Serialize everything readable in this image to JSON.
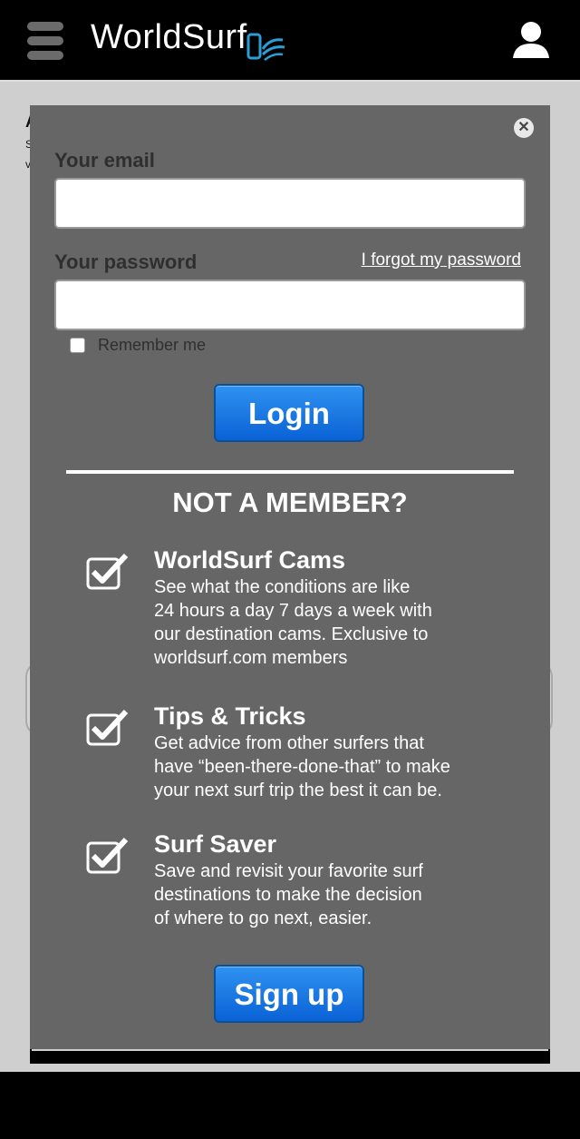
{
  "header": {
    "brand": "WorldSurf"
  },
  "login": {
    "email_label": "Your email",
    "email_value": "",
    "password_label": "Your password",
    "password_value": "",
    "forgot_link": "I forgot my password",
    "remember_label": "Remember me",
    "login_button": "Login"
  },
  "promo": {
    "heading": "NOT A MEMBER?",
    "features": [
      {
        "title": "WorldSurf Cams",
        "line1": "See what the conditions are like",
        "line2": "24 hours a day 7 days a week with",
        "line3": "our destination cams. Exclusive to",
        "line4": "worldsurf.com members"
      },
      {
        "title": "Tips & Tricks",
        "line1": "Get advice from other surfers that",
        "line2": "have “been-there-done-that” to make",
        "line3": "your next surf trip the best it can be."
      },
      {
        "title": "Surf Saver",
        "line1": "Save and revisit your favorite surf",
        "line2": "destinations to make the decision",
        "line3": "of where to go next, easier."
      }
    ],
    "signup_button": "Sign up"
  },
  "icons": {
    "menu": "hamburger-icon",
    "user": "user-icon",
    "close": "close-icon",
    "check": "checkmark-icon"
  },
  "colors": {
    "header_bg": "#000000",
    "modal_bg": "#666666",
    "button_blue": "#0a62d6",
    "page_bg": "#cfcfcf"
  }
}
